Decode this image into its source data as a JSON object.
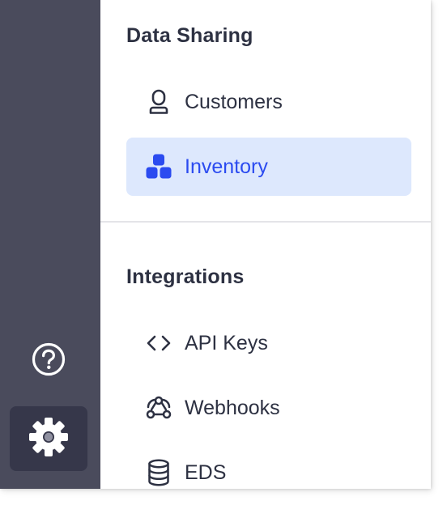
{
  "sections": {
    "data_sharing": {
      "title": "Data Sharing",
      "items": [
        {
          "label": "Customers",
          "icon": "user-icon",
          "active": false
        },
        {
          "label": "Inventory",
          "icon": "boxes-icon",
          "active": true
        }
      ]
    },
    "integrations": {
      "title": "Integrations",
      "items": [
        {
          "label": "API Keys",
          "icon": "code-brackets-icon",
          "active": false
        },
        {
          "label": "Webhooks",
          "icon": "webhook-icon",
          "active": false
        },
        {
          "label": "EDS",
          "icon": "database-icon",
          "active": false
        }
      ]
    }
  },
  "rail": {
    "help_icon": "question-circle-icon",
    "settings_icon": "gear-icon",
    "settings_active": true
  },
  "colors": {
    "rail_bg": "#4a4b5c",
    "active_bg": "#dde8fd",
    "accent": "#2b4bf0",
    "text": "#2d3142"
  }
}
